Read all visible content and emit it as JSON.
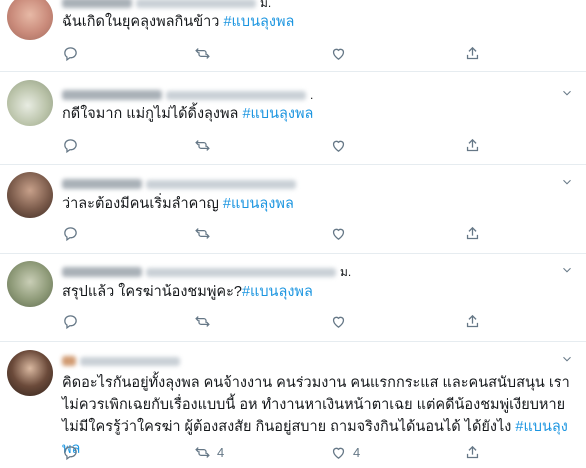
{
  "tweets": [
    {
      "trail": "ม.",
      "text": "ฉันเกิดในยุคลุงพลกินข้าว ",
      "hashtag": "#แบนลุงพล",
      "avatar_color": "#c98a7a",
      "retweets": "",
      "likes": ""
    },
    {
      "trail": ".",
      "text": "กดีใจมาก แม่กูไม่ได้ดิ้งลุงพล ",
      "hashtag": "#แบนลุงพล",
      "avatar_color": "#b9c2a8",
      "retweets": "",
      "likes": ""
    },
    {
      "trail": "",
      "text": "ว่าละต้องมีคนเริ่มลำคาญ ",
      "hashtag": "#แบนลุงพล",
      "avatar_color": "#7a5a4a",
      "retweets": "",
      "likes": ""
    },
    {
      "trail": "ม.",
      "text": "สรุปแล้ว ใครฆ่าน้องชมพู่คะ?",
      "hashtag": "#แบนลุงพล",
      "avatar_color": "#8e9a78",
      "retweets": "",
      "likes": ""
    },
    {
      "trail": "",
      "text": "คิดอะไรกันอยู่ทั้งลุงพล คนจ้างงาน คนร่วมงาน คนแรกกระแส และคนสนับสนุน เราไม่ควรเพิกเฉยกับเรื่องแบบนี้ อห ทำงานหาเงินหน้าตาเฉย แต่คดีน้องชมพู่เงียบหาย ไม่มีใครรู้ว่าใครฆ่า ผู้ต้องสงสัย กินอยู่สบาย ถามจริงกินได้นอนได้ ได้ยังไง  ",
      "hashtag": "#แบนลุงพล",
      "avatar_color": "#6b4a3a",
      "retweets": "4",
      "likes": "4"
    }
  ],
  "icons": {
    "reply": "reply-icon",
    "retweet": "retweet-icon",
    "like": "like-icon",
    "share": "share-icon",
    "caret": "chevron-down-icon"
  }
}
